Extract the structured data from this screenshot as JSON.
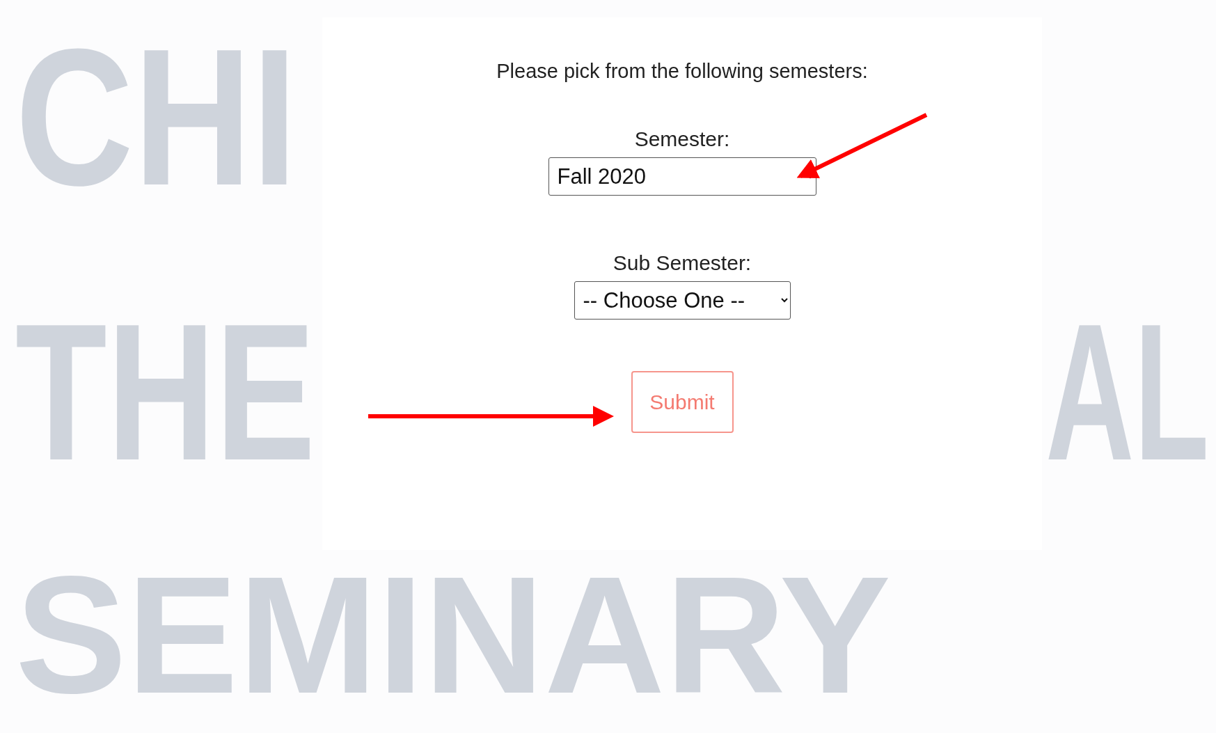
{
  "background_words": [
    "CHI",
    "THE",
    "AL",
    "SEMINARY"
  ],
  "prompt": "Please pick from the following semesters:",
  "fields": [
    {
      "label": "Semester:",
      "value": "Fall 2020"
    },
    {
      "label": "Sub Semester:",
      "value": "-- Choose One --"
    }
  ],
  "submit": {
    "label": "Submit"
  },
  "annotations": [
    {
      "kind": "arrow"
    },
    {
      "kind": "arrow"
    }
  ]
}
